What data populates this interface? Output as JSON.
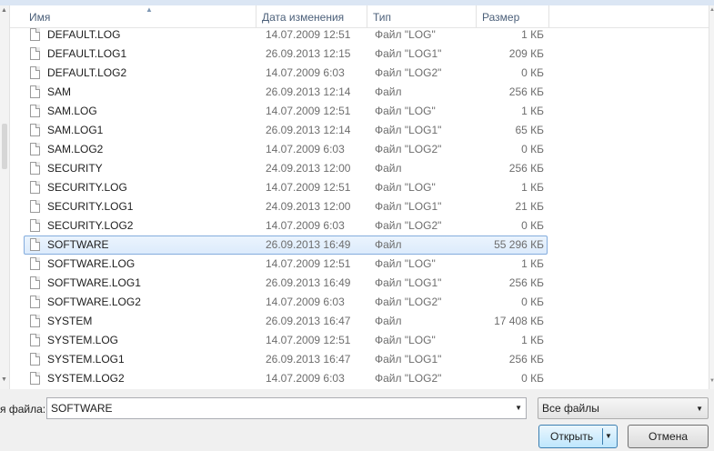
{
  "columns": {
    "name": "Имя",
    "date": "Дата изменения",
    "type": "Тип",
    "size": "Размер"
  },
  "files": [
    {
      "name": "DEFAULT.LOG",
      "date": "14.07.2009 12:51",
      "type": "Файл \"LOG\"",
      "size": "1 КБ"
    },
    {
      "name": "DEFAULT.LOG1",
      "date": "26.09.2013 12:15",
      "type": "Файл \"LOG1\"",
      "size": "209 КБ"
    },
    {
      "name": "DEFAULT.LOG2",
      "date": "14.07.2009 6:03",
      "type": "Файл \"LOG2\"",
      "size": "0 КБ"
    },
    {
      "name": "SAM",
      "date": "26.09.2013 12:14",
      "type": "Файл",
      "size": "256 КБ"
    },
    {
      "name": "SAM.LOG",
      "date": "14.07.2009 12:51",
      "type": "Файл \"LOG\"",
      "size": "1 КБ"
    },
    {
      "name": "SAM.LOG1",
      "date": "26.09.2013 12:14",
      "type": "Файл \"LOG1\"",
      "size": "65 КБ"
    },
    {
      "name": "SAM.LOG2",
      "date": "14.07.2009 6:03",
      "type": "Файл \"LOG2\"",
      "size": "0 КБ"
    },
    {
      "name": "SECURITY",
      "date": "24.09.2013 12:00",
      "type": "Файл",
      "size": "256 КБ"
    },
    {
      "name": "SECURITY.LOG",
      "date": "14.07.2009 12:51",
      "type": "Файл \"LOG\"",
      "size": "1 КБ"
    },
    {
      "name": "SECURITY.LOG1",
      "date": "24.09.2013 12:00",
      "type": "Файл \"LOG1\"",
      "size": "21 КБ"
    },
    {
      "name": "SECURITY.LOG2",
      "date": "14.07.2009 6:03",
      "type": "Файл \"LOG2\"",
      "size": "0 КБ"
    },
    {
      "name": "SOFTWARE",
      "date": "26.09.2013 16:49",
      "type": "Файл",
      "size": "55 296 КБ",
      "selected": true
    },
    {
      "name": "SOFTWARE.LOG",
      "date": "14.07.2009 12:51",
      "type": "Файл \"LOG\"",
      "size": "1 КБ"
    },
    {
      "name": "SOFTWARE.LOG1",
      "date": "26.09.2013 16:49",
      "type": "Файл \"LOG1\"",
      "size": "256 КБ"
    },
    {
      "name": "SOFTWARE.LOG2",
      "date": "14.07.2009 6:03",
      "type": "Файл \"LOG2\"",
      "size": "0 КБ"
    },
    {
      "name": "SYSTEM",
      "date": "26.09.2013 16:47",
      "type": "Файл",
      "size": "17 408 КБ"
    },
    {
      "name": "SYSTEM.LOG",
      "date": "14.07.2009 12:51",
      "type": "Файл \"LOG\"",
      "size": "1 КБ"
    },
    {
      "name": "SYSTEM.LOG1",
      "date": "26.09.2013 16:47",
      "type": "Файл \"LOG1\"",
      "size": "256 КБ"
    },
    {
      "name": "SYSTEM.LOG2",
      "date": "14.07.2009 6:03",
      "type": "Файл \"LOG2\"",
      "size": "0 КБ"
    }
  ],
  "footer": {
    "filename_label": "я файла:",
    "filename_value": "SOFTWARE",
    "filter_value": "Все файлы",
    "open_label": "Открыть",
    "cancel_label": "Отмена"
  },
  "icons": {
    "file": "file-icon",
    "dropdown": "chevron-down-icon",
    "sort": "sort-ascending-icon"
  },
  "colors": {
    "selection_border": "#84acdd",
    "selection_fill": "#dcebfc",
    "header_text": "#4c607a",
    "primary_button_border": "#3c7fb1"
  }
}
